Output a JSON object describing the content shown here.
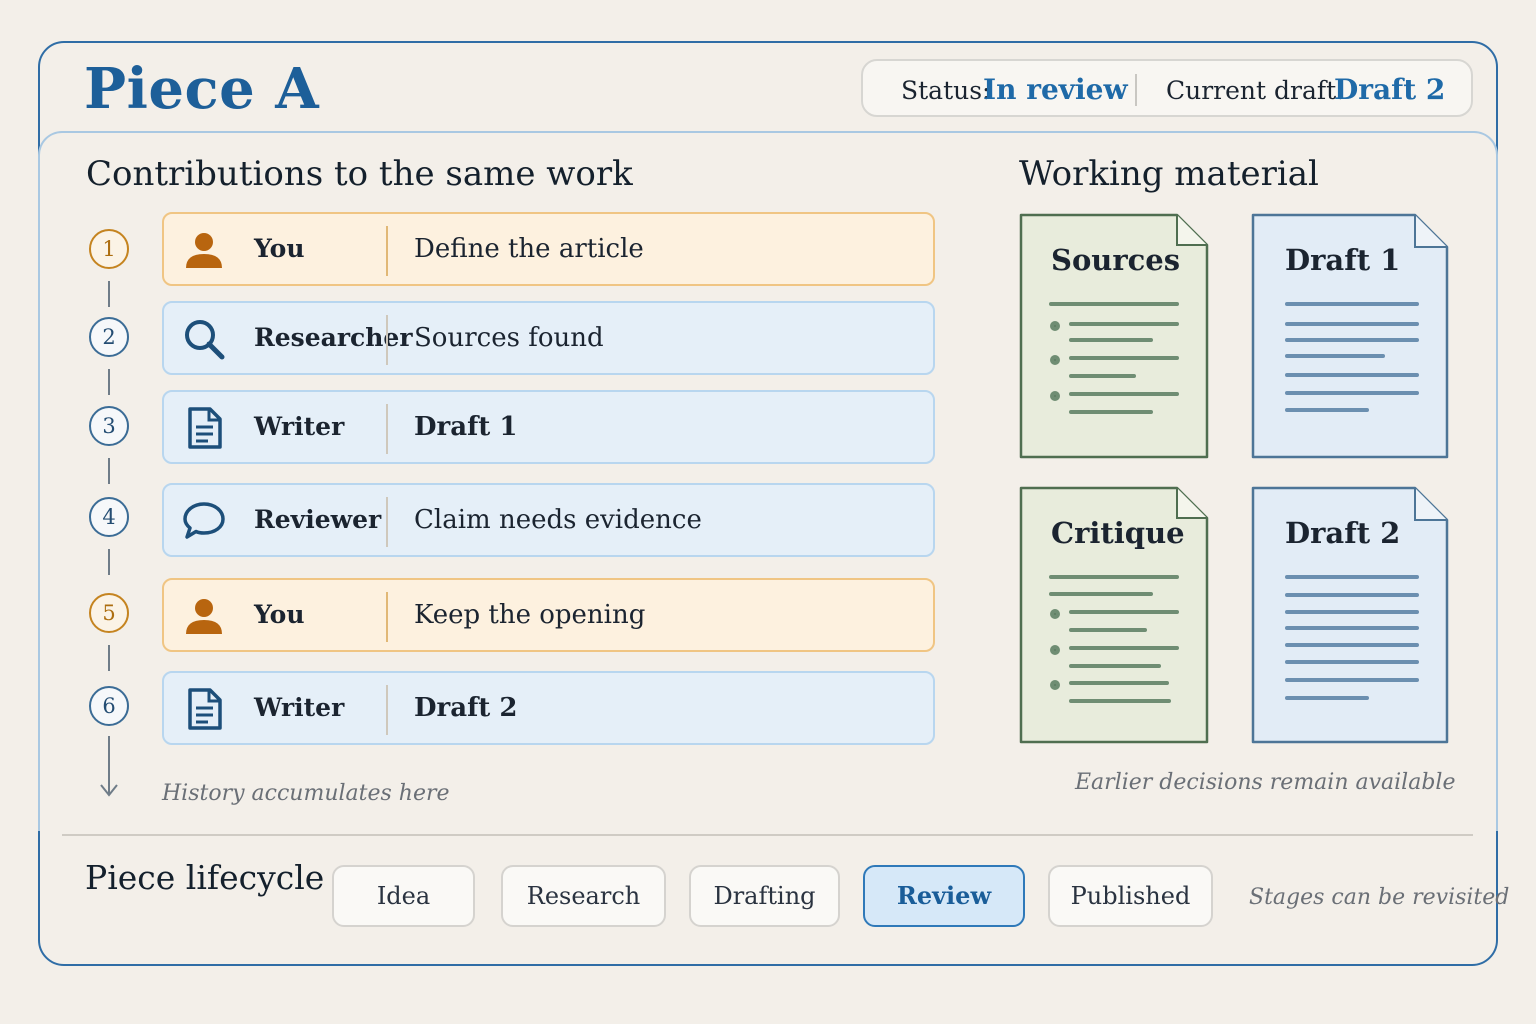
{
  "header": {
    "title": "Piece A",
    "status_label": "Status:",
    "status_value": "In review",
    "draft_label": "Current draft:",
    "draft_value": "Draft 2"
  },
  "contributions": {
    "heading": "Contributions to the same work",
    "items": [
      {
        "step": "1",
        "role": "You",
        "text": "Define the article",
        "icon": "person-icon",
        "kind": "you"
      },
      {
        "step": "2",
        "role": "Researcher",
        "text": "Sources found",
        "icon": "search-icon",
        "kind": "agent"
      },
      {
        "step": "3",
        "role": "Writer",
        "text": "Draft 1",
        "icon": "document-icon",
        "kind": "agent"
      },
      {
        "step": "4",
        "role": "Reviewer",
        "text": "Claim needs evidence",
        "icon": "comment-icon",
        "kind": "agent"
      },
      {
        "step": "5",
        "role": "You",
        "text": "Keep the opening",
        "icon": "person-icon",
        "kind": "you"
      },
      {
        "step": "6",
        "role": "Writer",
        "text": "Draft 2",
        "icon": "document-icon",
        "kind": "agent"
      }
    ],
    "footnote": "History accumulates here"
  },
  "material": {
    "heading": "Working material",
    "docs": [
      {
        "title": "Sources",
        "style": "green-list"
      },
      {
        "title": "Draft 1",
        "style": "blue-lines"
      },
      {
        "title": "Critique",
        "style": "green-list"
      },
      {
        "title": "Draft 2",
        "style": "blue-lines"
      }
    ],
    "footnote": "Earlier decisions remain available"
  },
  "lifecycle": {
    "heading": "Piece lifecycle",
    "stages": [
      "Idea",
      "Research",
      "Drafting",
      "Review",
      "Published"
    ],
    "active_stage": "Review",
    "footnote": "Stages can be revisited"
  },
  "colors": {
    "accent": "#1f6aa8",
    "you": "#c58420",
    "agent_row": "#e5eff8",
    "you_row": "#fdf1df",
    "doc_green": "#e8ecdc",
    "doc_blue": "#e2ecf6"
  }
}
